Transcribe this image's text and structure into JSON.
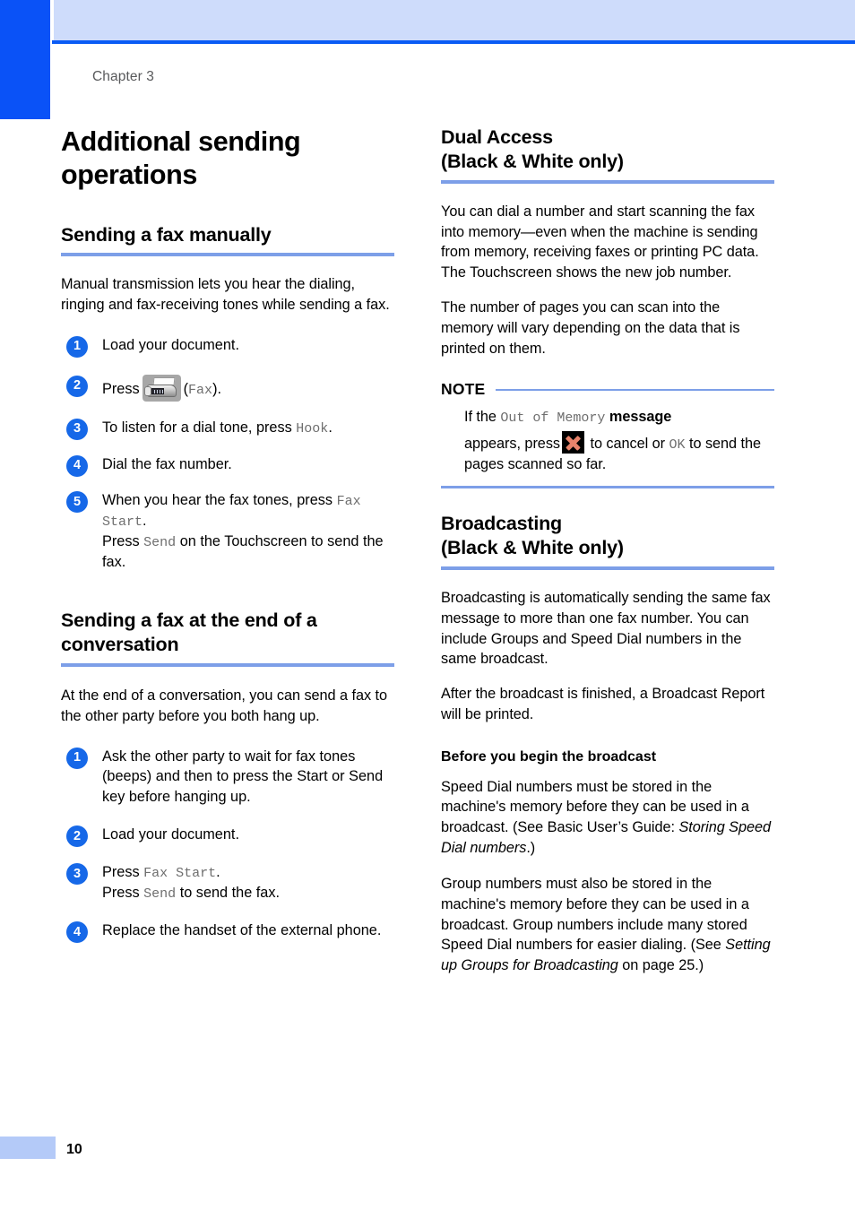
{
  "header": {
    "chapter_label": "Chapter 3",
    "band_color": "#cedcfb",
    "rule_color": "#0a5bf5",
    "tab_color": "#0a52f7"
  },
  "page_title": "Additional sending operations",
  "footer": {
    "page_number": "10",
    "bar_color": "#b4caf8"
  },
  "accent": {
    "heading_rule": "#7d9fe8",
    "step_circle": "#1668e8",
    "x_glyph": "#e8836b"
  },
  "left_column": {
    "section1": {
      "heading": "Sending a fax manually",
      "intro": "Manual transmission lets you hear the dialing, ringing and fax-receiving tones while sending a fax.",
      "steps": [
        {
          "num": "1",
          "text": "Load your document."
        },
        {
          "num": "2",
          "press_label": "Press",
          "icon": "fax-machine-icon",
          "paren_mono": "Fax",
          "tail": ").",
          "open_paren": "("
        },
        {
          "num": "3",
          "pre": "To listen for a dial tone, press ",
          "mono": "Hook",
          "post": "."
        },
        {
          "num": "4",
          "text": "Dial the fax number."
        },
        {
          "num": "5",
          "line1_pre": "When you hear the fax tones, press ",
          "line1_mono": "Fax Start",
          "line1_post": ".",
          "line2_pre": "Press ",
          "line2_mono": "Send",
          "line2_post": " on the Touchscreen to send the fax."
        }
      ]
    },
    "section2": {
      "heading": "Sending a fax at the end of a conversation",
      "intro": "At the end of a conversation, you can send a fax to the other party before you both hang up.",
      "steps": [
        {
          "num": "1",
          "text": "Ask the other party to wait for fax tones (beeps) and then to press the Start or Send key before hanging up."
        },
        {
          "num": "2",
          "text": "Load your document."
        },
        {
          "num": "3",
          "line1_pre": "Press ",
          "line1_mono": "Fax Start",
          "line1_post": ".",
          "line2_pre": "Press ",
          "line2_mono": "Send",
          "line2_post": " to send the fax."
        },
        {
          "num": "4",
          "text": "Replace the handset of the external phone."
        }
      ]
    }
  },
  "right_column": {
    "dual_access": {
      "heading_line1": "Dual Access",
      "heading_line2": "(Black & White only)",
      "para1": "You can dial a number and start scanning the fax into memory—even when the machine is sending from memory, receiving faxes or printing PC data. The Touchscreen shows the new job number.",
      "para2": "The number of pages you can scan into the memory will vary depending on the data that is printed on them."
    },
    "note": {
      "title": "NOTE",
      "line1_pre": "If the ",
      "line1_mono": "Out of Memory",
      "line1_post": " message",
      "line2_pre": "appears, press ",
      "line2_icon": "cancel-x-icon",
      "line2_mid": " to cancel or ",
      "line2_mono": "OK",
      "line2_post": " to send the pages scanned so far."
    },
    "broadcasting": {
      "heading_line1": "Broadcasting",
      "heading_line2": "(Black & White only)",
      "para1": "Broadcasting is automatically sending the same fax message to more than one fax number. You can include Groups and Speed Dial numbers in the same broadcast.",
      "para2": "After the broadcast is finished, a Broadcast Report will be printed.",
      "sub_heading": "Before you begin the broadcast",
      "para3_pre": "Speed Dial numbers must be stored in the machine's memory before they can be used in a broadcast. (See Basic User’s Guide: ",
      "para3_italic": "Storing Speed Dial numbers",
      "para3_post": ".)",
      "para4_pre": "Group numbers must also be stored in the machine's memory before they can be used in a broadcast. Group numbers include many stored Speed Dial numbers for easier dialing. (See ",
      "para4_italic": "Setting up Groups for Broadcasting",
      "para4_post": " on page 25.)"
    }
  }
}
